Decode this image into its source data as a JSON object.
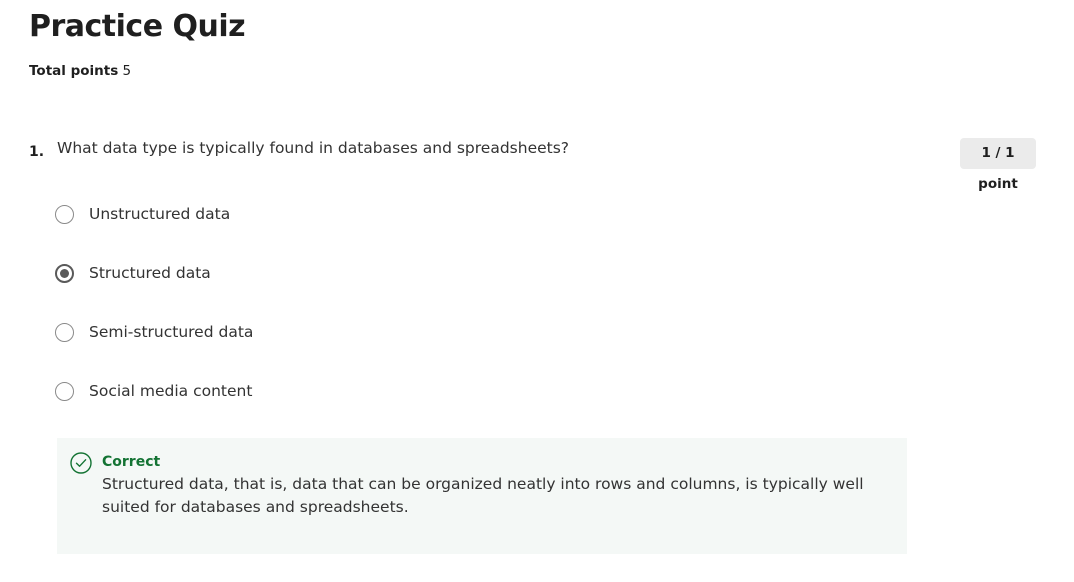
{
  "quiz": {
    "title": "Practice Quiz",
    "total_points_label": "Total points",
    "total_points_value": "5"
  },
  "question": {
    "number": "1.",
    "text": "What data type is typically found in databases and spreadsheets?",
    "points": "1 / 1 point",
    "options": [
      {
        "label": "Unstructured data",
        "selected": false
      },
      {
        "label": "Structured data",
        "selected": true
      },
      {
        "label": "Semi-structured data",
        "selected": false
      },
      {
        "label": "Social media content",
        "selected": false
      }
    ]
  },
  "feedback": {
    "status": "Correct",
    "explanation": "Structured data, that is, data that can be organized neatly into rows and columns, is typically well suited for databases and spreadsheets.",
    "icon": "check-circle-icon",
    "accent_color": "#137333"
  }
}
